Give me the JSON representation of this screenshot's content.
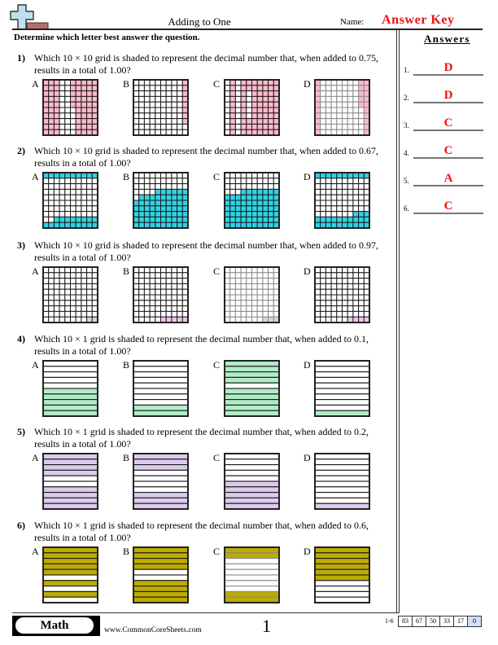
{
  "header": {
    "logo_icon": "plus-sign-logo",
    "title": "Adding to One",
    "name_label": "Name:",
    "name_value": "Answer Key"
  },
  "instructions": "Determine which letter best answer the question.",
  "questions": [
    {
      "number": "1)",
      "lines": [
        "Which 10 × 10 grid is shaded to represent the decimal number that, when added to 0.75,",
        "results in a total of 1.00?"
      ],
      "grid_type": "10x10",
      "shade_color": "#ffb9cc",
      "options": [
        {
          "label": "A",
          "rows": [
            "1110011111",
            "1110011111",
            "1110011111",
            "1110011111",
            "1110011111",
            "1110001111",
            "1110001111",
            "1110001111",
            "1110001111",
            "1110001111"
          ]
        },
        {
          "label": "B",
          "rows": [
            "0000000001",
            "0000000001",
            "0000000001",
            "0000000001",
            "0000000001",
            "0000000001",
            "0000000001",
            "0000000001",
            "0000000000",
            "0000000000"
          ]
        },
        {
          "label": "C",
          "rows": [
            "0101111111",
            "0101111111",
            "0101011111",
            "0101011111",
            "0101011111",
            "0101011111",
            "0101011111",
            "0101111111",
            "0101111111",
            "0101111111"
          ]
        },
        {
          "label": "D",
          "rows": [
            "1000000011",
            "1000000011",
            "1000000011",
            "1000000011",
            "1000000011",
            "1000000001",
            "1000000001",
            "1000000001",
            "1000000001",
            "1000000001"
          ]
        }
      ]
    },
    {
      "number": "2)",
      "lines": [
        "Which 10 × 10 grid is shaded to represent the decimal number that, when added to 0.67,",
        "results in a total of 1.00?"
      ],
      "grid_type": "10x10",
      "shade_color": "#2fd3e4",
      "options": [
        {
          "label": "A",
          "rows": [
            "1111111111",
            "0000000000",
            "0000000000",
            "0000000000",
            "0000000000",
            "0000000000",
            "0000000000",
            "0000000000",
            "0011111111",
            "1111111111"
          ]
        },
        {
          "label": "B",
          "rows": [
            "0000000000",
            "0000000000",
            "0000000000",
            "0000111111",
            "0111111111",
            "1111111111",
            "1111111111",
            "1111111111",
            "1111111111",
            "1111111111"
          ]
        },
        {
          "label": "C",
          "rows": [
            "0000000000",
            "0000000000",
            "0000000000",
            "0001111111",
            "1111111111",
            "1111111111",
            "1111111111",
            "1111111111",
            "1111111111",
            "1111111111"
          ]
        },
        {
          "label": "D",
          "rows": [
            "1111111111",
            "0000000000",
            "0000000000",
            "0000000000",
            "0000000000",
            "0000000000",
            "0000000000",
            "0000000111",
            "1111111111",
            "1111111111"
          ]
        }
      ]
    },
    {
      "number": "3)",
      "lines": [
        "Which 10 × 10 grid is shaded to represent the decimal number that, when added to 0.97,",
        "results in a total of 1.00?"
      ],
      "grid_type": "10x10",
      "shade_color": "#eec8ee",
      "options": [
        {
          "label": "A",
          "rows": [
            "0000000000",
            "0000000000",
            "0000000000",
            "0000000000",
            "0000000000",
            "0000000000",
            "0000000000",
            "0000000000",
            "0000000000",
            "0000000011"
          ]
        },
        {
          "label": "B",
          "rows": [
            "0000000000",
            "0000000000",
            "0000000000",
            "0000000000",
            "0000000000",
            "0000000000",
            "0000000000",
            "0000000000",
            "0000000000",
            "0000011111"
          ]
        },
        {
          "label": "C",
          "rows": [
            "0000000000",
            "0000000000",
            "0000000000",
            "0000000000",
            "0000000000",
            "0000000000",
            "0000000000",
            "0000000000",
            "0000000000",
            "0000000111"
          ]
        },
        {
          "label": "D",
          "rows": [
            "0000000000",
            "0000000000",
            "0000000000",
            "0000000000",
            "0000000000",
            "0000000000",
            "0000000000",
            "0000000000",
            "0000000000",
            "0000001111"
          ]
        }
      ]
    },
    {
      "number": "4)",
      "lines": [
        "Which 10 × 1 grid is shaded to represent the decimal number that, when added to 0.1,",
        "results in a total of 1.00?"
      ],
      "grid_type": "10x1",
      "shade_color": "#b1ecc7",
      "options": [
        {
          "label": "A",
          "rows": [
            "0",
            "0",
            "0",
            "0",
            "0",
            "1",
            "1",
            "1",
            "1",
            "1"
          ]
        },
        {
          "label": "B",
          "rows": [
            "0",
            "0",
            "0",
            "0",
            "0",
            "0",
            "0",
            "0",
            "1",
            "1"
          ]
        },
        {
          "label": "C",
          "rows": [
            "1",
            "1",
            "1",
            "1",
            "0",
            "1",
            "1",
            "1",
            "1",
            "1"
          ]
        },
        {
          "label": "D",
          "rows": [
            "0",
            "0",
            "0",
            "0",
            "0",
            "0",
            "0",
            "0",
            "0",
            "1"
          ]
        }
      ]
    },
    {
      "number": "5)",
      "lines": [
        "Which 10 × 1 grid is shaded to represent the decimal number that, when added to 0.2,",
        "results in a total of 1.00?"
      ],
      "grid_type": "10x1",
      "shade_color": "#dccbec",
      "options": [
        {
          "label": "A",
          "rows": [
            "1",
            "1",
            "1",
            "1",
            "0",
            "0",
            "1",
            "1",
            "1",
            "1"
          ]
        },
        {
          "label": "B",
          "rows": [
            "1",
            "1",
            "1",
            "0",
            "0",
            "0",
            "0",
            "1",
            "1",
            "1"
          ]
        },
        {
          "label": "C",
          "rows": [
            "0",
            "0",
            "0",
            "0",
            "0",
            "1",
            "1",
            "1",
            "1",
            "1"
          ]
        },
        {
          "label": "D",
          "rows": [
            "0",
            "0",
            "0",
            "0",
            "0",
            "0",
            "0",
            "0",
            "0",
            "1"
          ]
        }
      ]
    },
    {
      "number": "6)",
      "lines": [
        "Which 10 × 1 grid is shaded to represent the decimal number that, when added to 0.6,",
        "results in a total of 1.00?"
      ],
      "grid_type": "10x1",
      "shade_color": "#bdac00",
      "options": [
        {
          "label": "A",
          "rows": [
            "1",
            "1",
            "1",
            "1",
            "1",
            "0",
            "1",
            "0",
            "1",
            "0"
          ]
        },
        {
          "label": "B",
          "rows": [
            "1",
            "1",
            "1",
            "1",
            "0",
            "0",
            "1",
            "1",
            "1",
            "1"
          ]
        },
        {
          "label": "C",
          "rows": [
            "1",
            "1",
            "0",
            "0",
            "0",
            "0",
            "0",
            "0",
            "1",
            "1"
          ]
        },
        {
          "label": "D",
          "rows": [
            "1",
            "1",
            "1",
            "1",
            "1",
            "1",
            "0",
            "0",
            "0",
            "0"
          ]
        }
      ]
    }
  ],
  "answers_panel": {
    "title": "Answers",
    "items": [
      {
        "number": "1.",
        "answer": "D"
      },
      {
        "number": "2.",
        "answer": "D"
      },
      {
        "number": "3.",
        "answer": "C"
      },
      {
        "number": "4.",
        "answer": "C"
      },
      {
        "number": "5.",
        "answer": "A"
      },
      {
        "number": "6.",
        "answer": "C"
      }
    ]
  },
  "footer": {
    "subject": "Math",
    "website": "www.CommonCoreSheets.com",
    "page_number": "1",
    "score_range": "1-6",
    "scores": [
      "83",
      "67",
      "50",
      "33",
      "17",
      "0"
    ],
    "highlight_color": "#cfe0ff"
  }
}
